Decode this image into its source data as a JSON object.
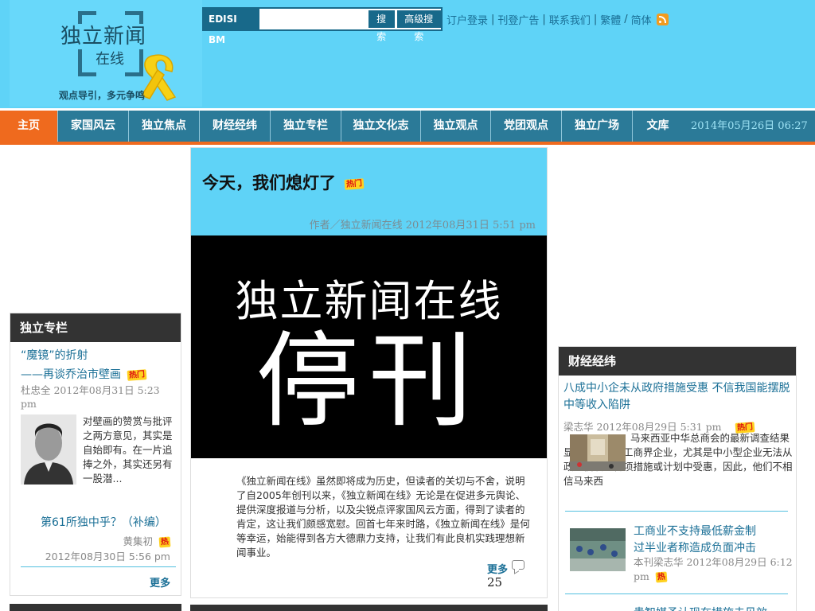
{
  "header": {
    "logo_main": "独立新闻",
    "logo_sub": "在线",
    "logo_tagline": "观点导引，多元争鸣",
    "search_label": "EDISI BM",
    "search_placeholder": "",
    "search_button": "搜索",
    "advanced_search_button": "高级搜索",
    "links": [
      "订户登录",
      "刊登广告",
      "联系我们",
      "繁體",
      "简体"
    ],
    "separator": "|",
    "lang_separator": "/"
  },
  "nav": {
    "items": [
      "主页",
      "家国风云",
      "独立焦点",
      "财经经纬",
      "独立专栏",
      "独立文化志",
      "独立观点",
      "党团观点",
      "独立广场",
      "文库"
    ],
    "active_index": 0,
    "date": "2014年05月26日 06:27"
  },
  "left": {
    "heading": "独立专栏",
    "article1": {
      "title_line1": "“魔镜”的折射",
      "title_line2": "——再谈乔治市壁画",
      "hot_label": "热门",
      "meta": "杜忠全 2012年08月31日 5:23 pm",
      "excerpt": "对壁画的赞赏与批评之两方意见，其实是自始即有。在一片追捧之外，其实还另有一股潜..."
    },
    "article2": {
      "title": "第61所独中乎？（补编）",
      "author": "黄集初",
      "hot_label": "热",
      "date": "2012年08月30日 5:56 pm"
    },
    "more": "更多"
  },
  "center": {
    "title": "今天，我们熄灯了",
    "hot_label": "热门",
    "author_line": "作者／独立新闻在线 2012年08月31日 5:51 pm",
    "banner_line1": "独立新闻在线",
    "banner_line2": "停刊",
    "body": "《独立新闻在线》虽然即将成为历史，但读者的关切与不舍，说明了自2005年创刊以来，《独立新闻在线》无论是在促进多元舆论、提供深度报道与分析，以及尖锐点评家国风云方面，得到了读者的肯定，这让我们颇感宽慰。回首七年来时路，《独立新闻在线》是何等幸运，始能得到各方大德鼎力支持，让我们有此良机实践理想新闻事业。",
    "more": "更多",
    "comment_count": "25"
  },
  "right": {
    "heading": "财经经纬",
    "article1": {
      "title": "八成中小企未从政府措施受惠 不信我国能摆脱中等收入陷阱",
      "meta": "梁志华 2012年08月29日 5:31 pm",
      "hot_label": "热门",
      "excerpt": "马来西亚中华总商会的最新调查结果显示，近八成工商界企业，尤其是中小型企业无法从政府倡议的各项措施或计划中受惠，因此，他们不相信马来西"
    },
    "article2": {
      "title_line1": "工商业不支持最低薪金制",
      "title_line2": "过半业者称造成负面冲击",
      "meta": "本刊梁志华 2012年08月29日 6:12 pm",
      "hot_label": "热"
    },
    "article3": {
      "title": "贵智媒予认现在措施未见效"
    }
  }
}
